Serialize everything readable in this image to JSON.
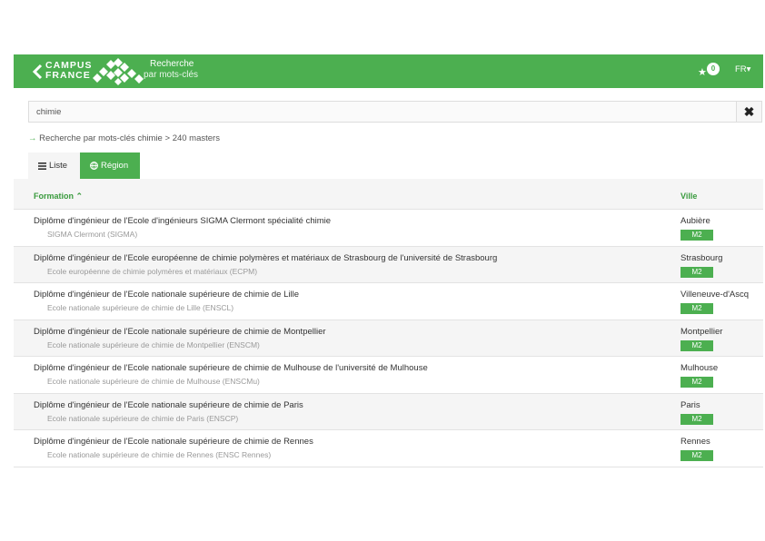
{
  "header": {
    "brand_line1": "CAMPUS",
    "brand_line2": "FRANCE",
    "title_line1": "Recherche",
    "title_line2": "par mots-clés",
    "favorites_count": "0",
    "language": "FR",
    "accent_color": "#4caf50"
  },
  "search": {
    "value": "chimie",
    "clear_icon": "close-icon"
  },
  "breadcrumb": {
    "arrow": "→",
    "link": "Recherche par mots-clés",
    "term": "chimie",
    "separator": ">",
    "count": "240 masters"
  },
  "tabs": {
    "list_label": "Liste",
    "region_label": "Région"
  },
  "table": {
    "columns": [
      "Formation ⌃",
      "Ville"
    ],
    "rows": [
      {
        "title": "Diplôme d'ingénieur de l'Ecole d'ingénieurs SIGMA Clermont spécialité chimie",
        "school": "SIGMA Clermont (SIGMA)",
        "city": "Aubière",
        "level": "M2"
      },
      {
        "title": "Diplôme d'ingénieur de l'Ecole européenne de chimie polymères et matériaux de Strasbourg de l'université de Strasbourg",
        "school": "Ecole européenne de chimie polymères et matériaux (ECPM)",
        "city": "Strasbourg",
        "level": "M2"
      },
      {
        "title": "Diplôme d'ingénieur de l'Ecole nationale supérieure de chimie de Lille",
        "school": "Ecole nationale supérieure de chimie de Lille (ENSCL)",
        "city": "Villeneuve-d'Ascq",
        "level": "M2"
      },
      {
        "title": "Diplôme d'ingénieur de l'Ecole nationale supérieure de chimie de Montpellier",
        "school": "Ecole nationale supérieure de chimie de Montpellier (ENSCM)",
        "city": "Montpellier",
        "level": "M2"
      },
      {
        "title": "Diplôme d'ingénieur de l'Ecole nationale supérieure de chimie de Mulhouse de l'université de Mulhouse",
        "school": "Ecole nationale supérieure de chimie de Mulhouse (ENSCMu)",
        "city": "Mulhouse",
        "level": "M2"
      },
      {
        "title": "Diplôme d'ingénieur de l'Ecole nationale supérieure de chimie de Paris",
        "school": "Ecole nationale supérieure de chimie de Paris (ENSCP)",
        "city": "Paris",
        "level": "M2"
      },
      {
        "title": "Diplôme d'ingénieur de l'Ecole nationale supérieure de chimie de Rennes",
        "school": "Ecole nationale supérieure de chimie de Rennes (ENSC Rennes)",
        "city": "Rennes",
        "level": "M2"
      }
    ]
  }
}
